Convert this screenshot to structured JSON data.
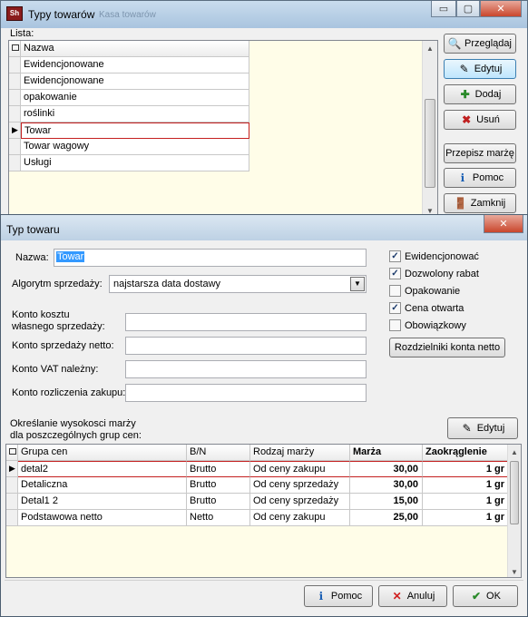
{
  "top_window": {
    "title": "Typy towarów",
    "ghost_title": "Kasa towarów",
    "list_label": "Lista:",
    "column_header": "Nazwa",
    "rows": [
      "Ewidencjonowane",
      "Ewidencjonowane",
      "opakowanie",
      "roślinki",
      "Towar",
      "Towar wagowy",
      "Usługi"
    ],
    "selected_row": "Towar",
    "buttons": {
      "browse": "Przeglądaj",
      "edit": "Edytuj",
      "add": "Dodaj",
      "remove": "Usuń",
      "copy_margin": "Przepisz marżę",
      "help": "Pomoc",
      "close": "Zamknij"
    },
    "controls": {
      "minimize": "▭",
      "maximize": "▢",
      "close": "✕"
    }
  },
  "dialog": {
    "title": "Typ towaru",
    "close_glyph": "✕",
    "labels": {
      "name": "Nazwa:",
      "algorithm": "Algorytm sprzedaży:",
      "cost_account_1": "Konto kosztu",
      "cost_account_2": "własnego sprzedaży:",
      "net_sales_account": "Konto sprzedaży netto:",
      "vat_account": "Konto VAT należny:",
      "settlement_account": "Konto rozliczenia zakupu:",
      "margin_section_1": "Określanie wysokosci marży",
      "margin_section_2": "dla poszczególnych grup cen:"
    },
    "name_value": "Towar",
    "algorithm_value": "najstarsza data dostawy",
    "checkboxes": [
      {
        "label": "Ewidencjonować",
        "checked": true
      },
      {
        "label": "Dozwolony rabat",
        "checked": true
      },
      {
        "label": "Opakowanie",
        "checked": false
      },
      {
        "label": "Cena otwarta",
        "checked": true
      },
      {
        "label": "Obowiązkowy",
        "checked": false
      }
    ],
    "check_glyph": "✓",
    "buttons": {
      "net_dividers": "Rozdzielniki konta netto",
      "edit": "Edytuj",
      "help": "Pomoc",
      "cancel": "Anuluj",
      "ok": "OK"
    },
    "table": {
      "headers": [
        "Grupa cen",
        "B/N",
        "Rodzaj marży",
        "Marża",
        "Zaokrąglenie"
      ],
      "rows": [
        {
          "group": "detal2",
          "bn": "Brutto",
          "type": "Od ceny zakupu",
          "margin": "30,00",
          "rounding": "1 gr"
        },
        {
          "group": "Detaliczna",
          "bn": "Brutto",
          "type": "Od ceny sprzedaży",
          "margin": "30,00",
          "rounding": "1 gr"
        },
        {
          "group": "Detal1 2",
          "bn": "Brutto",
          "type": "Od ceny sprzedaży",
          "margin": "15,00",
          "rounding": "1 gr"
        },
        {
          "group": "Podstawowa netto",
          "bn": "Netto",
          "type": "Od ceny zakupu",
          "margin": "25,00",
          "rounding": "1 gr"
        }
      ]
    }
  }
}
